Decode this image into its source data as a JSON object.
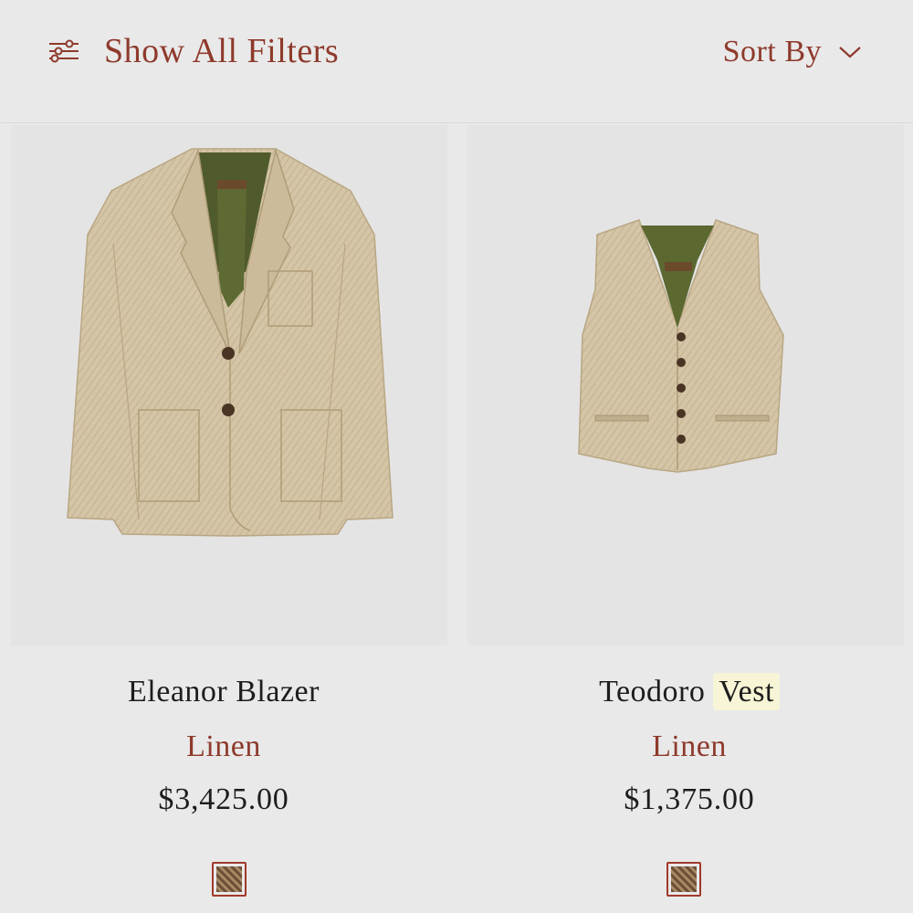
{
  "toolbar": {
    "filters_label": "Show All Filters",
    "filters_icon": "sliders-icon",
    "sort_label": "Sort By",
    "sort_icon": "chevron-down-icon"
  },
  "colors": {
    "accent": "#8e3a2c",
    "text": "#1d1d1d",
    "background": "#e9e9e9",
    "highlight": "#f7f5d6"
  },
  "products": [
    {
      "name": "Eleanor Blazer",
      "material": "Linen",
      "price": "$3,425.00",
      "image": "blazer-image",
      "swatch": "herringbone-swatch"
    },
    {
      "name_part1": "Teodoro",
      "name_part2": "Vest",
      "material": "Linen",
      "price": "$1,375.00",
      "image": "vest-image",
      "swatch": "herringbone-swatch"
    }
  ]
}
